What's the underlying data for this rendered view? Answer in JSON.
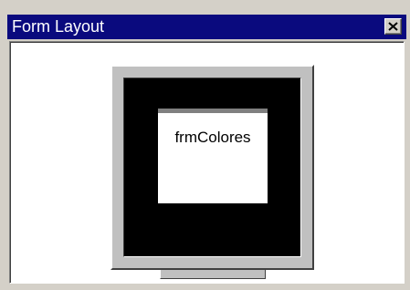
{
  "window": {
    "title": "Form Layout",
    "close_icon": "close-icon"
  },
  "preview": {
    "form_name": "frmColores"
  },
  "colors": {
    "titlebar": "#0a0a7e",
    "window_bg": "#d4d0c8",
    "client_bg": "#ffffff",
    "screen": "#000000",
    "bezel": "#c0c0c0"
  }
}
